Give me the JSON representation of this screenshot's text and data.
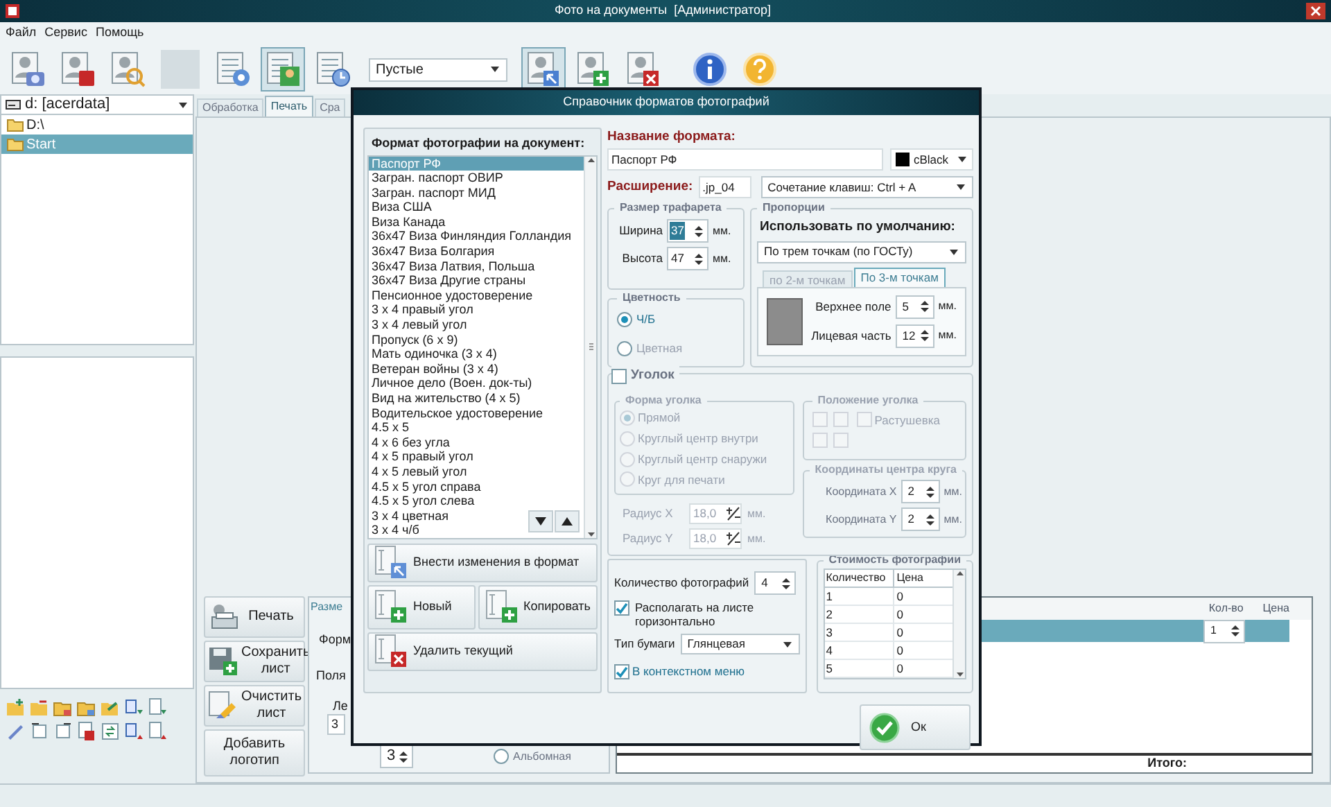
{
  "window": {
    "title": "Фото на документы  [Администратор]"
  },
  "menu": [
    "Файл",
    "Сервис",
    "Помощь"
  ],
  "toolbar": {
    "filter_select": "Пустые"
  },
  "drive_select": "d: [acerdata]",
  "folder_tree": [
    {
      "label": "D:\\",
      "selected": false
    },
    {
      "label": "Start",
      "selected": true
    }
  ],
  "main_tabs": [
    {
      "label": "Обработка",
      "selected": false
    },
    {
      "label": "Печать",
      "selected": true
    },
    {
      "label": "Сра",
      "selected": false
    }
  ],
  "print_actions": [
    {
      "label": "Печать",
      "kind": "print"
    },
    {
      "label": "Сохранить лист",
      "kind": "save"
    },
    {
      "label": "Очистить лист",
      "kind": "clear"
    },
    {
      "label": "Добавить логотип",
      "kind": "plain"
    }
  ],
  "layout_panel": {
    "tab": "Разме",
    "format_label": "Форм",
    "margins_label": "Поля",
    "left_label": "Ле",
    "left_value": "3",
    "second_value": "3",
    "orientation_option": {
      "label": "Альбомная",
      "selected": false
    }
  },
  "order_table": {
    "columns": [
      "Кол-во",
      "Цена"
    ],
    "rows": [
      {
        "quantity": "1",
        "selected": true
      }
    ],
    "total_label": "Итого:"
  },
  "dialog": {
    "title": "Справочник форматов фотографий",
    "format_list": {
      "label": "Формат фотографии на документ:",
      "items": [
        {
          "label": "Паспорт РФ",
          "selected": true
        },
        {
          "label": "Загран. паспорт ОВИР",
          "selected": false
        },
        {
          "label": "Загран. паспорт МИД",
          "selected": false
        },
        {
          "label": "Виза США",
          "selected": false
        },
        {
          "label": "Виза Канада",
          "selected": false
        },
        {
          "label": "36х47 Виза Финляндия Голландия",
          "selected": false
        },
        {
          "label": "36х47 Виза Болгария",
          "selected": false
        },
        {
          "label": "36х47 Виза Латвия, Польша",
          "selected": false
        },
        {
          "label": "36х47 Виза Другие страны",
          "selected": false
        },
        {
          "label": "Пенсионное удостоверение",
          "selected": false
        },
        {
          "label": "3 х 4 правый угол",
          "selected": false
        },
        {
          "label": "3 х 4 левый угол",
          "selected": false
        },
        {
          "label": "Пропуск (6 х 9)",
          "selected": false
        },
        {
          "label": "Мать одиночка (3 х 4)",
          "selected": false
        },
        {
          "label": "Ветеран войны (3 х 4)",
          "selected": false
        },
        {
          "label": "Личное дело (Воен. док-ты)",
          "selected": false
        },
        {
          "label": "Вид на жительство (4 х 5)",
          "selected": false
        },
        {
          "label": "Водительское удостоверение",
          "selected": false
        },
        {
          "label": "4.5 х 5",
          "selected": false
        },
        {
          "label": "4 х 6 без угла",
          "selected": false
        },
        {
          "label": "4 х 5 правый угол",
          "selected": false
        },
        {
          "label": "4 х 5 левый угол",
          "selected": false
        },
        {
          "label": "4.5 х 5 угол справа",
          "selected": false
        },
        {
          "label": "4.5 х 5 угол слева",
          "selected": false
        },
        {
          "label": "3 х 4 цветная",
          "selected": false
        },
        {
          "label": "3 х 4 ч/б",
          "selected": false
        }
      ]
    },
    "format_actions": [
      {
        "label": "Внести изменения в формат",
        "kind": "edit"
      },
      {
        "label": "Новый",
        "kind": "add"
      },
      {
        "label": "Копировать",
        "kind": "add"
      },
      {
        "label": "Удалить текущий",
        "kind": "delete"
      }
    ],
    "name_label": "Название формата:",
    "name_value": "Паспорт РФ",
    "color_select": "cBlack",
    "extension_label": "Расширение:",
    "extension_value": ".jp_04",
    "hotkey_select": "Сочетание клавиш: Ctrl + A",
    "stencil_size": {
      "title": "Размер трафарета",
      "fields": [
        {
          "label": "Ширина",
          "value": "37",
          "unit": "мм.",
          "selected": true
        },
        {
          "label": "Высота",
          "value": "47",
          "unit": "мм.",
          "selected": false
        }
      ]
    },
    "colorness": {
      "title": "Цветность",
      "options": [
        {
          "label": "Ч/Б",
          "selected": true
        },
        {
          "label": "Цветная",
          "selected": false
        }
      ]
    },
    "proportions": {
      "title": "Пропорции",
      "default_label": "Использовать по умолчанию:",
      "default_select": "По трем точкам (по ГОСТу)",
      "tabs": [
        {
          "label": "по 2-м точкам",
          "selected": false
        },
        {
          "label": "По 3-м точкам",
          "selected": true
        }
      ],
      "fields": [
        {
          "label": "Верхнее поле",
          "value": "5",
          "unit": "мм."
        },
        {
          "label": "Лицевая часть",
          "value": "12",
          "unit": "мм."
        }
      ]
    },
    "corner": {
      "label": "Уголок",
      "checked": false,
      "shape": {
        "title": "Форма уголка",
        "options": [
          {
            "label": "Прямой",
            "selected": true
          },
          {
            "label": "Круглый центр внутри",
            "selected": false
          },
          {
            "label": "Круглый центр снаружи",
            "selected": false
          },
          {
            "label": "Круг для печати",
            "selected": false
          }
        ]
      },
      "radii": [
        {
          "label": "Радиус X",
          "value": "18,0",
          "unit": "мм."
        },
        {
          "label": "Радиус Y",
          "value": "18,0",
          "unit": "мм."
        }
      ],
      "position": {
        "title": "Положение уголка",
        "corners": [
          {
            "checked": false
          },
          {
            "checked": false
          },
          {
            "checked": false
          },
          {
            "checked": false
          }
        ],
        "feather": {
          "label": "Растушевка",
          "checked": false
        }
      },
      "center": {
        "title": "Координаты центра круга",
        "fields": [
          {
            "label": "Координата X",
            "value": "2",
            "unit": "мм."
          },
          {
            "label": "Координата Y",
            "value": "2",
            "unit": "мм."
          }
        ]
      }
    },
    "print_settings": {
      "count_label": "Количество фотографий",
      "count_value": "4",
      "horizontal": {
        "label": "Располагать на листе горизонтально",
        "checked": true
      },
      "paper_label": "Тип бумаги",
      "paper_select": "Глянцевая",
      "context_menu": {
        "label": "В контекстном меню",
        "checked": true
      }
    },
    "price": {
      "title": "Стоимость фотографии",
      "columns": [
        "Количество",
        "Цена"
      ],
      "rows": [
        [
          "1",
          "0"
        ],
        [
          "2",
          "0"
        ],
        [
          "3",
          "0"
        ],
        [
          "4",
          "0"
        ],
        [
          "5",
          "0"
        ]
      ]
    },
    "ok_button": "Ок"
  }
}
